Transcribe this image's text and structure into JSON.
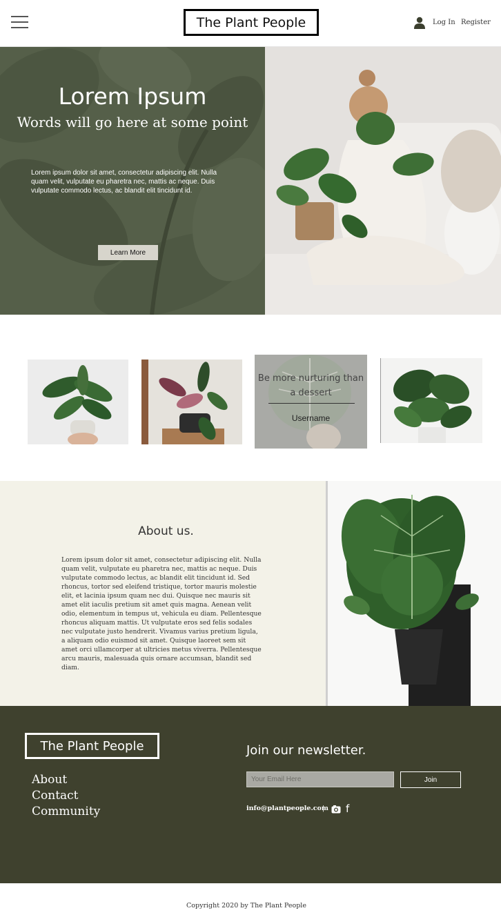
{
  "header": {
    "logo_text": "The Plant People",
    "login_label": "Log In",
    "register_label": "Register"
  },
  "hero": {
    "title": "Lorem Ipsum",
    "subtitle": "Words will go here at some point",
    "body": "Lorem ipsum dolor sit amet, consectetur adipiscing elit. Nulla quam velit, vulputate eu pharetra nec, mattis ac neque. Duis vulputate commodo lectus, ac blandit elit tincidunt id.",
    "button_label": "Learn More"
  },
  "gallery": {
    "quote": "Be more nurturing than a dessert",
    "username": "Username"
  },
  "about": {
    "title": "About us.",
    "body": "Lorem ipsum dolor sit amet, consectetur adipiscing elit. Nulla quam velit, vulputate eu pharetra nec, mattis ac neque. Duis vulputate commodo lectus, ac blandit elit tincidunt id. Sed rhoncus, tortor sed eleifend tristique, tortor mauris molestie elit, et lacinia ipsum quam nec dui. Quisque nec mauris sit amet elit iaculis pretium sit amet quis magna. Aenean velit odio, elementum in tempus ut, vehicula eu diam. Pellentesque rhoncus aliquam mattis. Ut vulputate eros sed felis sodales nec vulputate justo hendrerit. Vivamus varius pretium ligula, a aliquam odio euismod sit amet. Quisque laoreet sem sit amet orci ullamcorper at ultricies metus viverra. Pellentesque arcu mauris, malesuada quis ornare accumsan, blandit sed diam."
  },
  "footer": {
    "logo_text": "The Plant People",
    "links": [
      "About",
      "Contact",
      "Community"
    ],
    "newsletter_title": "Join our newsletter.",
    "email_placeholder": "Your Email Here",
    "join_label": "Join",
    "contact_email": "info@plantpeople.com",
    "separator": "|",
    "facebook_glyph": "f"
  },
  "copyright": "Copyright 2020 by The Plant People",
  "colors": {
    "hero_green": "#555f49",
    "about_bg": "#f3f2e8",
    "footer_bg": "#3f412e",
    "button_bg": "#d7d5cc"
  },
  "icons": [
    "hamburger-menu-icon",
    "user-icon",
    "instagram-icon",
    "facebook-icon"
  ]
}
